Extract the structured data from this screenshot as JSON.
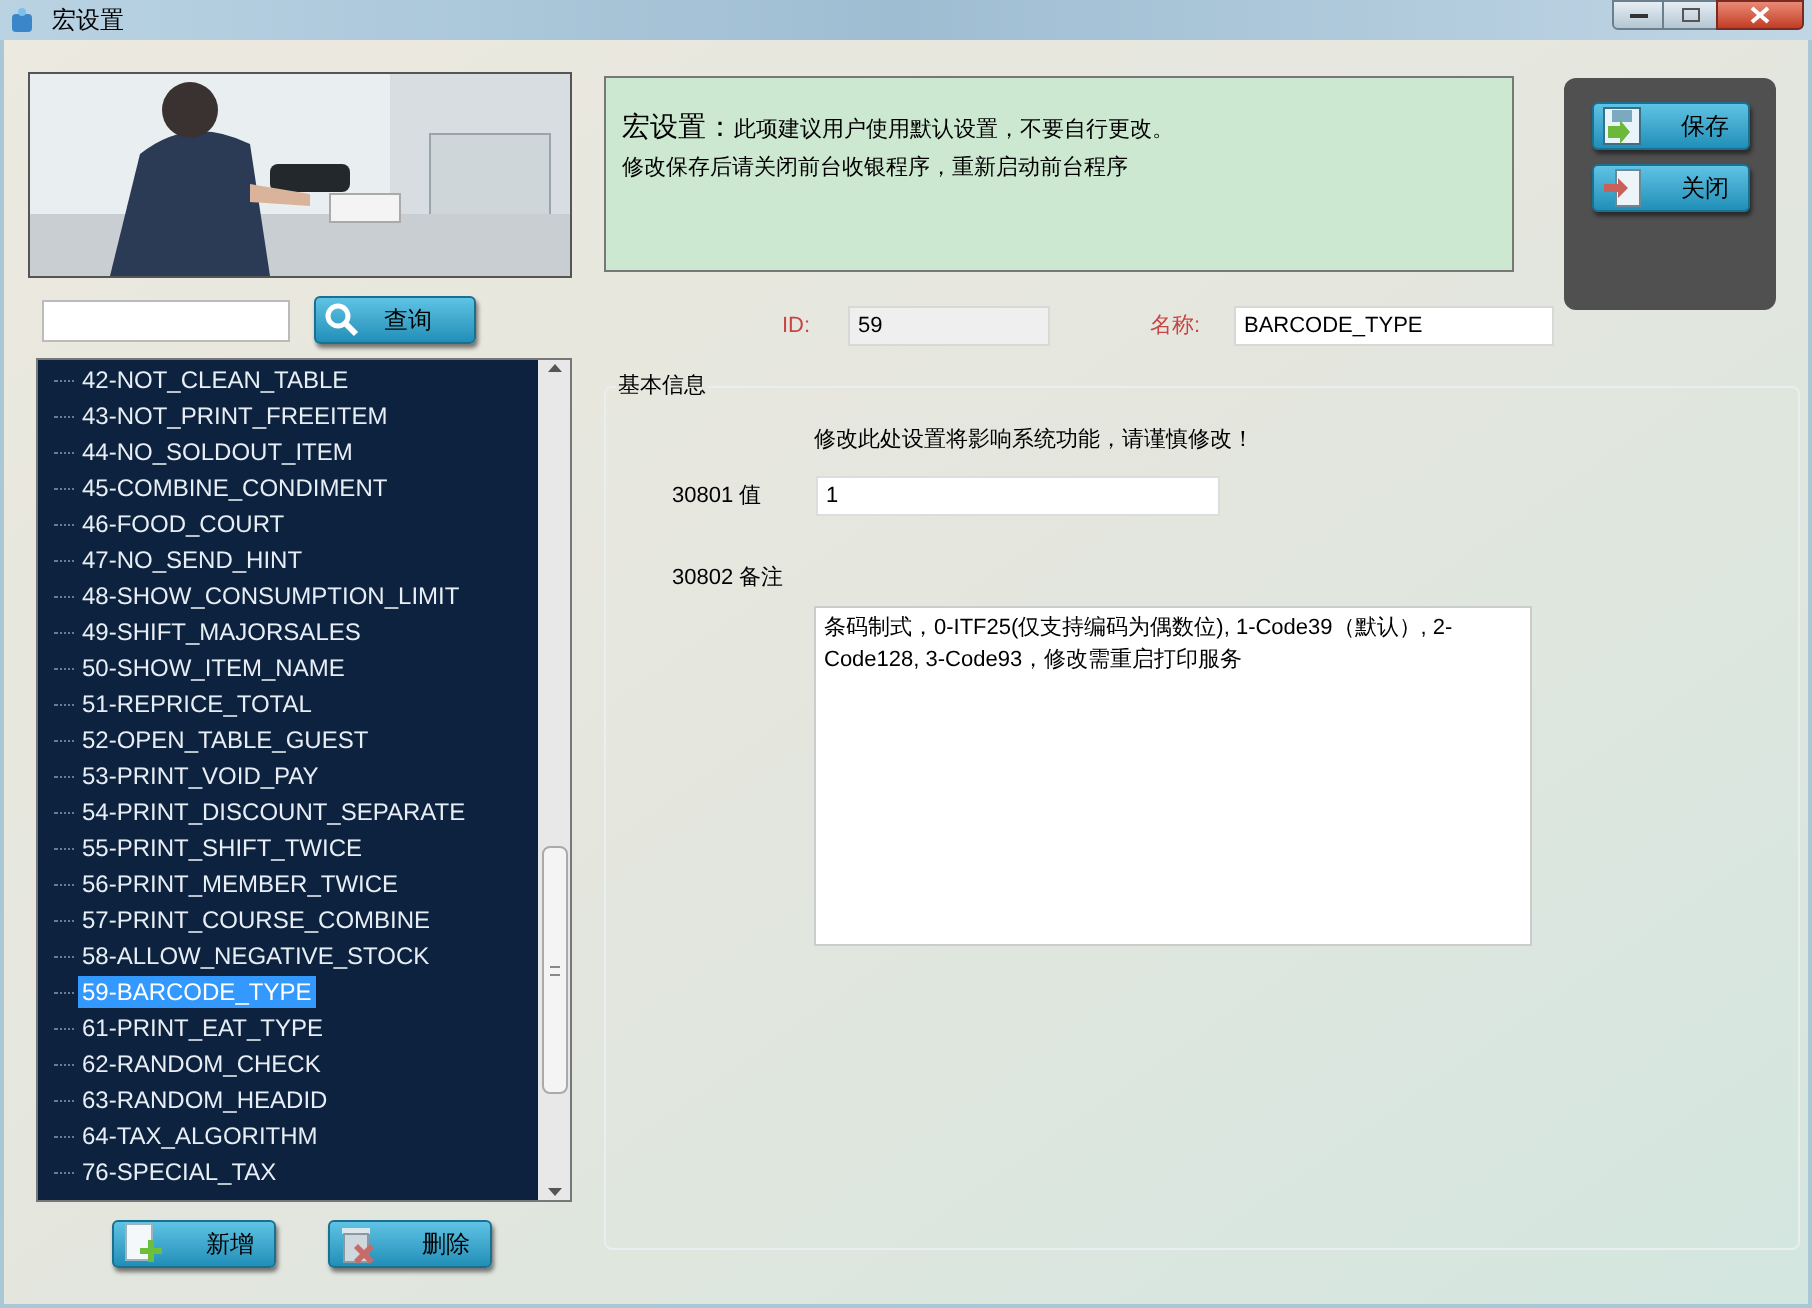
{
  "window": {
    "title": "宏设置"
  },
  "search": {
    "button": "查询"
  },
  "macro_list": {
    "items": [
      {
        "label": "42-NOT_CLEAN_TABLE",
        "selected": false
      },
      {
        "label": "43-NOT_PRINT_FREEITEM",
        "selected": false
      },
      {
        "label": "44-NO_SOLDOUT_ITEM",
        "selected": false
      },
      {
        "label": "45-COMBINE_CONDIMENT",
        "selected": false
      },
      {
        "label": "46-FOOD_COURT",
        "selected": false
      },
      {
        "label": "47-NO_SEND_HINT",
        "selected": false
      },
      {
        "label": "48-SHOW_CONSUMPTION_LIMIT",
        "selected": false
      },
      {
        "label": "49-SHIFT_MAJORSALES",
        "selected": false
      },
      {
        "label": "50-SHOW_ITEM_NAME",
        "selected": false
      },
      {
        "label": "51-REPRICE_TOTAL",
        "selected": false
      },
      {
        "label": "52-OPEN_TABLE_GUEST",
        "selected": false
      },
      {
        "label": "53-PRINT_VOID_PAY",
        "selected": false
      },
      {
        "label": "54-PRINT_DISCOUNT_SEPARATE",
        "selected": false
      },
      {
        "label": "55-PRINT_SHIFT_TWICE",
        "selected": false
      },
      {
        "label": "56-PRINT_MEMBER_TWICE",
        "selected": false
      },
      {
        "label": "57-PRINT_COURSE_COMBINE",
        "selected": false
      },
      {
        "label": "58-ALLOW_NEGATIVE_STOCK",
        "selected": false
      },
      {
        "label": "59-BARCODE_TYPE",
        "selected": true
      },
      {
        "label": "61-PRINT_EAT_TYPE",
        "selected": false
      },
      {
        "label": "62-RANDOM_CHECK",
        "selected": false
      },
      {
        "label": "63-RANDOM_HEADID",
        "selected": false
      },
      {
        "label": "64-TAX_ALGORITHM",
        "selected": false
      },
      {
        "label": "76-SPECIAL_TAX",
        "selected": false
      }
    ]
  },
  "list_buttons": [
    "新增",
    "删除"
  ],
  "notice": {
    "title": "宏设置：",
    "lines": [
      "此项建议用户使用默认设置，不要自行更改。",
      "修改保存后请关闭前台收银程序，重新启动前台程序"
    ]
  },
  "actions": [
    "保存",
    "关闭"
  ],
  "id_field": {
    "label": "ID:",
    "value": "59"
  },
  "name_field": {
    "label": "名称:",
    "value": "BARCODE_TYPE"
  },
  "basic_info": {
    "legend": "基本信息",
    "warning": "修改此处设置将影响系统功能，请谨慎修改！",
    "value_label": "30801 值",
    "value": "1",
    "remark_label": "30802 备注",
    "remark": "条码制式，0-ITF25(仅支持编码为偶数位), 1-Code39（默认）, 2-Code128, 3-Code93，修改需重启打印服务"
  }
}
